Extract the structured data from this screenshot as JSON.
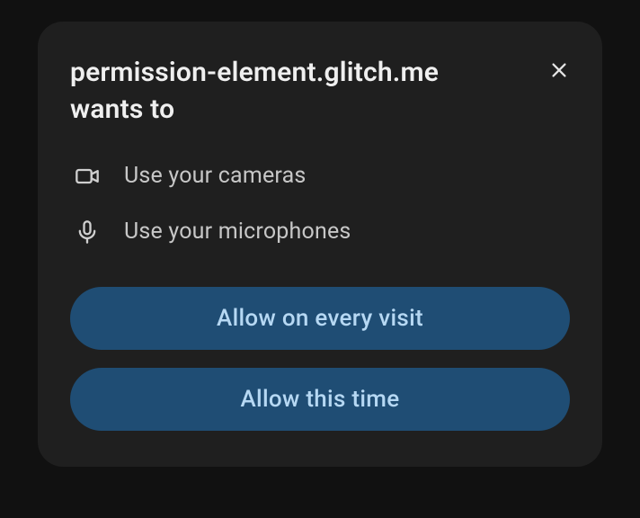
{
  "dialog": {
    "title": "permission-element.glitch.me wants to",
    "permissions": [
      {
        "icon": "camera-icon",
        "label": "Use your cameras"
      },
      {
        "icon": "microphone-icon",
        "label": "Use your microphones"
      }
    ],
    "buttons": {
      "allow_every_visit": "Allow on every visit",
      "allow_this_time": "Allow this time"
    }
  }
}
